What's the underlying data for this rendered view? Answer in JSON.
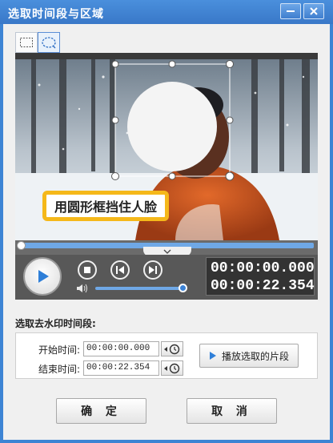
{
  "window": {
    "title": "选取时间段与区域"
  },
  "toolbar": {
    "tools": [
      {
        "icon": "rectangle-select-icon",
        "active": false
      },
      {
        "icon": "ellipse-select-icon",
        "active": true
      }
    ]
  },
  "preview": {
    "caption": "用圆形框挡住人脸",
    "caption_border_color": "#f5b81a",
    "mask_shape": "circle"
  },
  "player": {
    "seek_position_percent": 0,
    "volume_percent": 100,
    "current_time": "00:00:00.000",
    "total_time": "00:00:22.354",
    "accent_color": "#3b82d6"
  },
  "segment": {
    "section_label": "选取去水印时间段:",
    "start_label": "开始时间:",
    "start_value": "00:00:00.000",
    "end_label": "结束时间:",
    "end_value": "00:00:22.354",
    "play_segment_label": "播放选取的片段"
  },
  "footer": {
    "ok_label": "确 定",
    "cancel_label": "取 消"
  }
}
